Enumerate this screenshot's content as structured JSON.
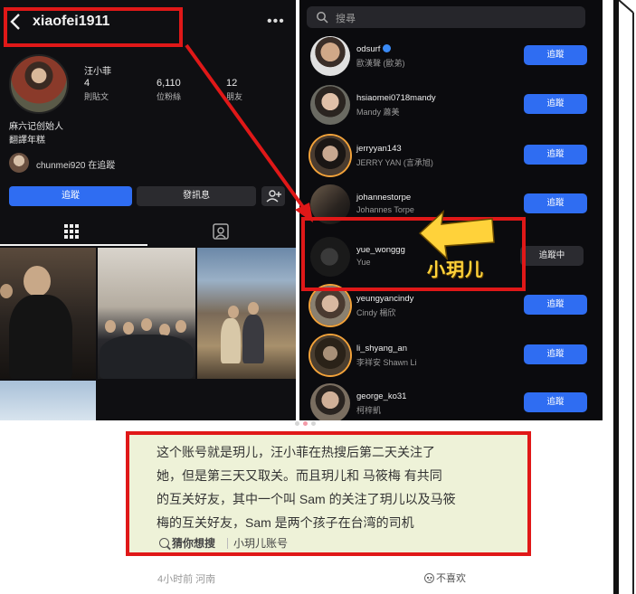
{
  "profile": {
    "username": "xiaofei1911",
    "display_name": "汪小菲",
    "stats": [
      {
        "num": "4",
        "label": "則貼文"
      },
      {
        "num": "6,110",
        "label": "位粉絲"
      },
      {
        "num": "12",
        "label": "朋友"
      }
    ],
    "bio_line1": "麻六记创始人",
    "bio_line2": "翻譯年糕",
    "followed_by": "chunmei920 在追蹤",
    "follow_button": "追蹤",
    "message_button": "發訊息"
  },
  "following": {
    "search_placeholder": "搜尋",
    "rows": [
      {
        "name": "odsurf",
        "sub": "歐漢聲 (歐弟)",
        "button": "追蹤",
        "verified": true
      },
      {
        "name": "hsiaomei0718mandy",
        "sub": "Mandy 蕭美",
        "button": "追蹤"
      },
      {
        "name": "jerryyan143",
        "sub": "JERRY YAN (言承旭)",
        "button": "追蹤"
      },
      {
        "name": "johannestorpe",
        "sub": "Johannes Torpe",
        "button": "追蹤"
      },
      {
        "name": "yue_wonggg",
        "sub": "Yue",
        "button": "追蹤中"
      },
      {
        "name": "yeungyancindy",
        "sub": "Cindy 楊欣",
        "button": "追蹤"
      },
      {
        "name": "li_shyang_an",
        "sub": "李祥安 Shawn Li",
        "button": "追蹤"
      },
      {
        "name": "george_ko31",
        "sub": "柯梓凱",
        "button": "追蹤"
      }
    ]
  },
  "annotation_label": "小玥儿",
  "caption": {
    "line1": "这个账号就是玥儿，汪小菲在热搜后第二天关注了",
    "line2": "她，但是第三天又取关。而且玥儿和 马筱梅 有共同",
    "line3": "的互关好友，其中一个叫 Sam 的关注了玥儿以及马筱",
    "line4": "梅的互关好友，Sam 是两个孩子在台湾的司机",
    "guess_label": "猜你想搜",
    "guess_keyword": "小玥儿账号"
  },
  "meta": {
    "time_location": "4小时前 河南",
    "dislike": "不喜欢"
  },
  "colors": {
    "highlight_red": "#e01818",
    "button_blue": "#2f6df2",
    "caption_bg": "#eef2d8",
    "annotation_yellow": "#ffd23a"
  }
}
